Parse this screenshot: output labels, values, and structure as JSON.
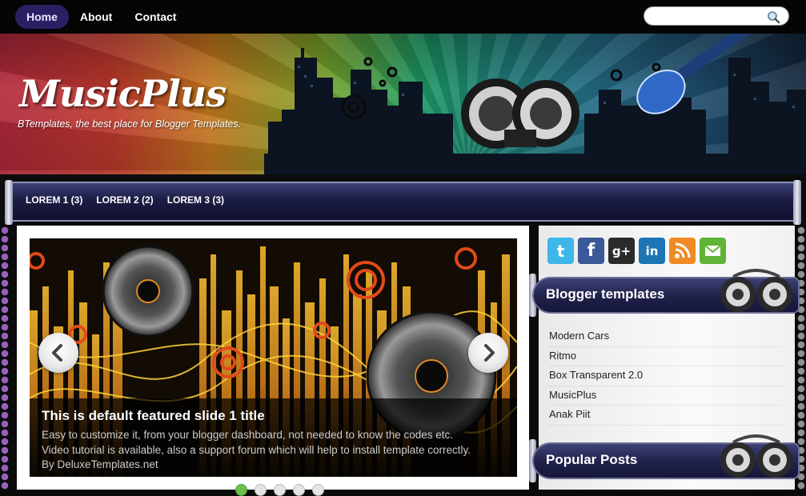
{
  "topnav": {
    "items": [
      {
        "label": "Home",
        "active": true
      },
      {
        "label": "About",
        "active": false
      },
      {
        "label": "Contact",
        "active": false
      }
    ],
    "search_placeholder": ""
  },
  "header": {
    "title": "MusicPlus",
    "tagline": "BTemplates, the best place for Blogger Templates."
  },
  "categories": [
    "LOREM 1 (3)",
    "LOREM 2 (2)",
    "LOREM 3 (3)"
  ],
  "slider": {
    "title": "This is default featured slide 1 title",
    "lines": [
      "Easy to customize it, from your blogger dashboard, not needed to know the codes etc.",
      "Video tutorial is available, also a support forum which will help to install template correctly.",
      "By DeluxeTemplates.net"
    ],
    "slide_count": 5,
    "active_slide": 1
  },
  "social": [
    {
      "name": "twitter-icon",
      "color": "#3fb6e8"
    },
    {
      "name": "facebook-icon",
      "color": "#3b5998"
    },
    {
      "name": "google-plus-icon",
      "color": "#2b2b2b"
    },
    {
      "name": "linkedin-icon",
      "color": "#1d75b3"
    },
    {
      "name": "rss-icon",
      "color": "#f08a24"
    },
    {
      "name": "email-icon",
      "color": "#5fb336"
    }
  ],
  "widgets": {
    "blogger": {
      "title": "Blogger templates",
      "items": [
        "Modern Cars",
        "Ritmo",
        "Box Transparent 2.0",
        "MusicPlus",
        "Anak Piit"
      ]
    },
    "popular": {
      "title": "Popular Posts"
    }
  },
  "colors": {
    "nav_active": "#2a1f63",
    "category_bar": "#1c1d44"
  }
}
